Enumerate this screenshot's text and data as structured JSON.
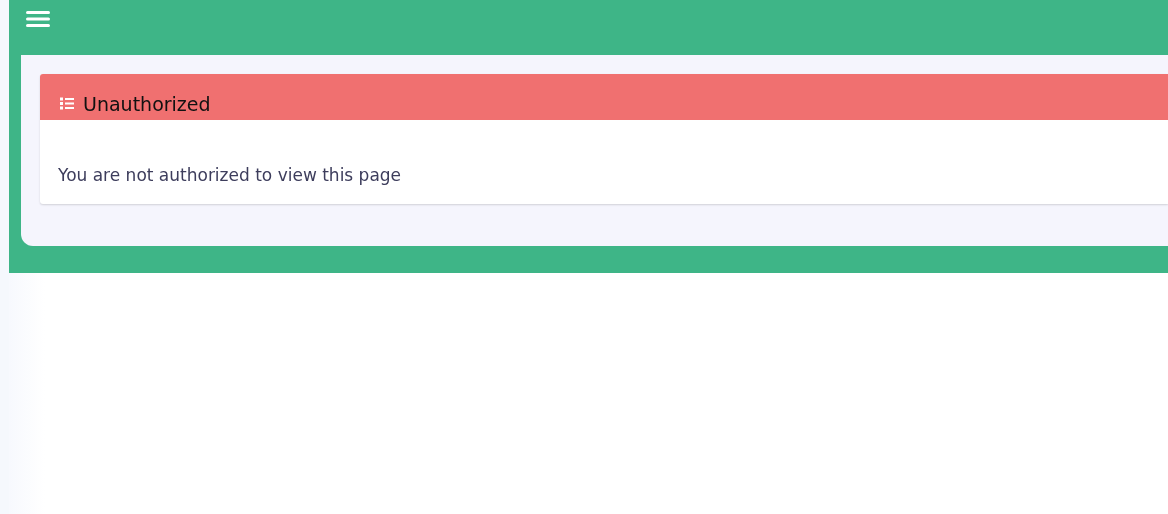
{
  "card": {
    "title": "Unauthorized",
    "message": "You are not authorized to view this page"
  }
}
